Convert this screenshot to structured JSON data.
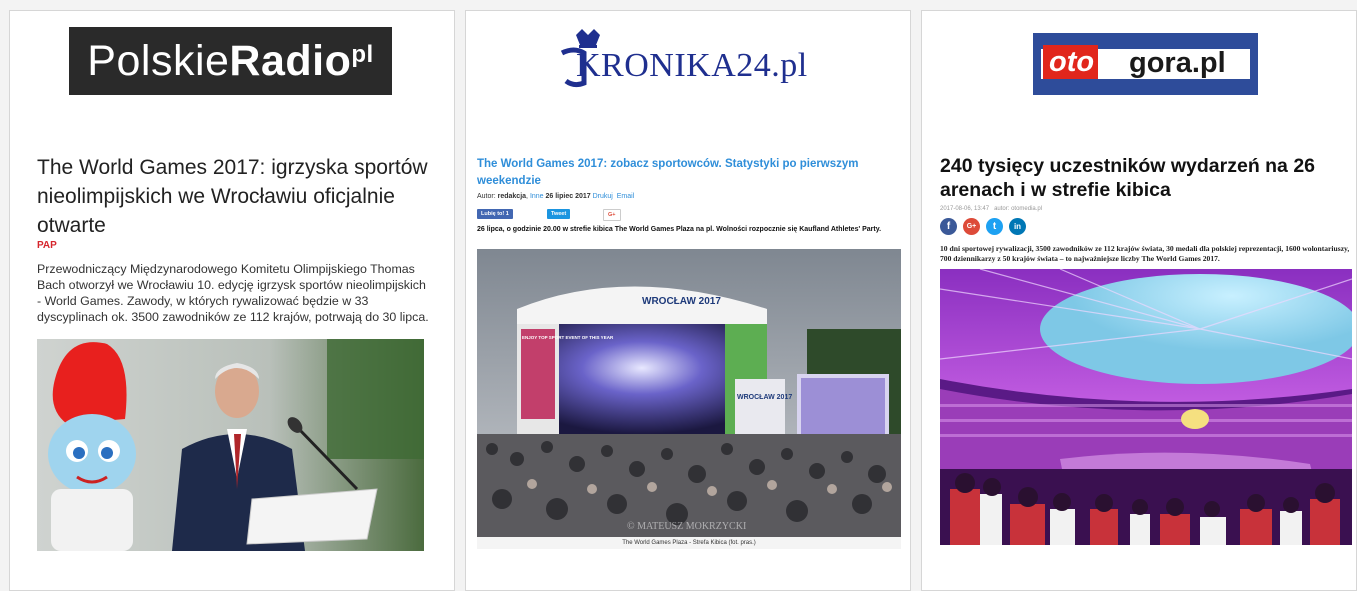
{
  "cards": [
    {
      "logo": {
        "prefix": "Polskie",
        "bold": "Radio",
        "suffix": "pl"
      },
      "title": "The World Games 2017: igrzyska sportów nieolimpijskich we Wrocławiu oficjalnie otwarte",
      "source": "PAP",
      "lead": "Przewodniczący Międzynarodowego Komitetu Olimpijskiego Thomas Bach otworzył we Wrocławiu 10. edycję igrzysk sportów nieolimpijskich - World Games. Zawody, w których rywalizować będzie w 33 dyscyplinach ok. 3500 zawodników ze 112 krajów, potrwają do 30 lipca."
    },
    {
      "logo": {
        "text": "KRONIKA24.pl"
      },
      "title": "The World Games 2017: zobacz sportowców. Statystyki po pierwszym weekendzie",
      "meta": {
        "author_label": "Autor: ",
        "author": "redakcja",
        "sep": ", ",
        "category": "Inne",
        "date": " 26 lipiec 2017 ",
        "print": "Drukuj",
        "email": "Email"
      },
      "social": {
        "like": "Lubię to! 1",
        "tweet": "Tweet",
        "gplus": "G+"
      },
      "lead": "26 lipca, o godzinie 20.00 w strefie kibica The World Games Plaza na pl. Wolności rozpocznie się Kaufland Athletes' Party.",
      "photo_text": {
        "stage": "WROCŁAW 2017",
        "banner_1": "ENJOY TOP SPORT EVENT OF THIS YEAR",
        "banner_2": "WROCŁAW 2017",
        "watermark": "© MATEUSZ MOKRZYCKI"
      },
      "caption": "The World Games Plaza - Strefa Kibica (fot. pras.)"
    },
    {
      "logo": {
        "part1": "oto",
        "part2": "gora.pl"
      },
      "title": "240 tysięcy uczestników wydarzeń na 26 arenach i w strefie kibica",
      "meta": {
        "date": "2017-08-06, 13:47",
        "author": "autor: otomedia.pl"
      },
      "social": {
        "facebook": "f",
        "google": "G+",
        "twitter": "t",
        "linkedin": "in"
      },
      "lead": "10 dni sportowej rywalizacji, 3500 zawodników ze 112 krajów świata, 30 medali dla polskiej reprezentacji, 1600 wolontariuszy, 700 dziennikarzy z 50 krajów świata – to najważniejsze liczby The World Games 2017."
    }
  ],
  "colors": {
    "pr_source": "#d6262d",
    "kr_link": "#2f8ed9",
    "ot_red": "#e1261c",
    "ot_blue": "#2e4c9a",
    "fb": "#3b5998",
    "tw": "#1da1f2",
    "gp": "#dd4b39",
    "li": "#0077b5"
  }
}
